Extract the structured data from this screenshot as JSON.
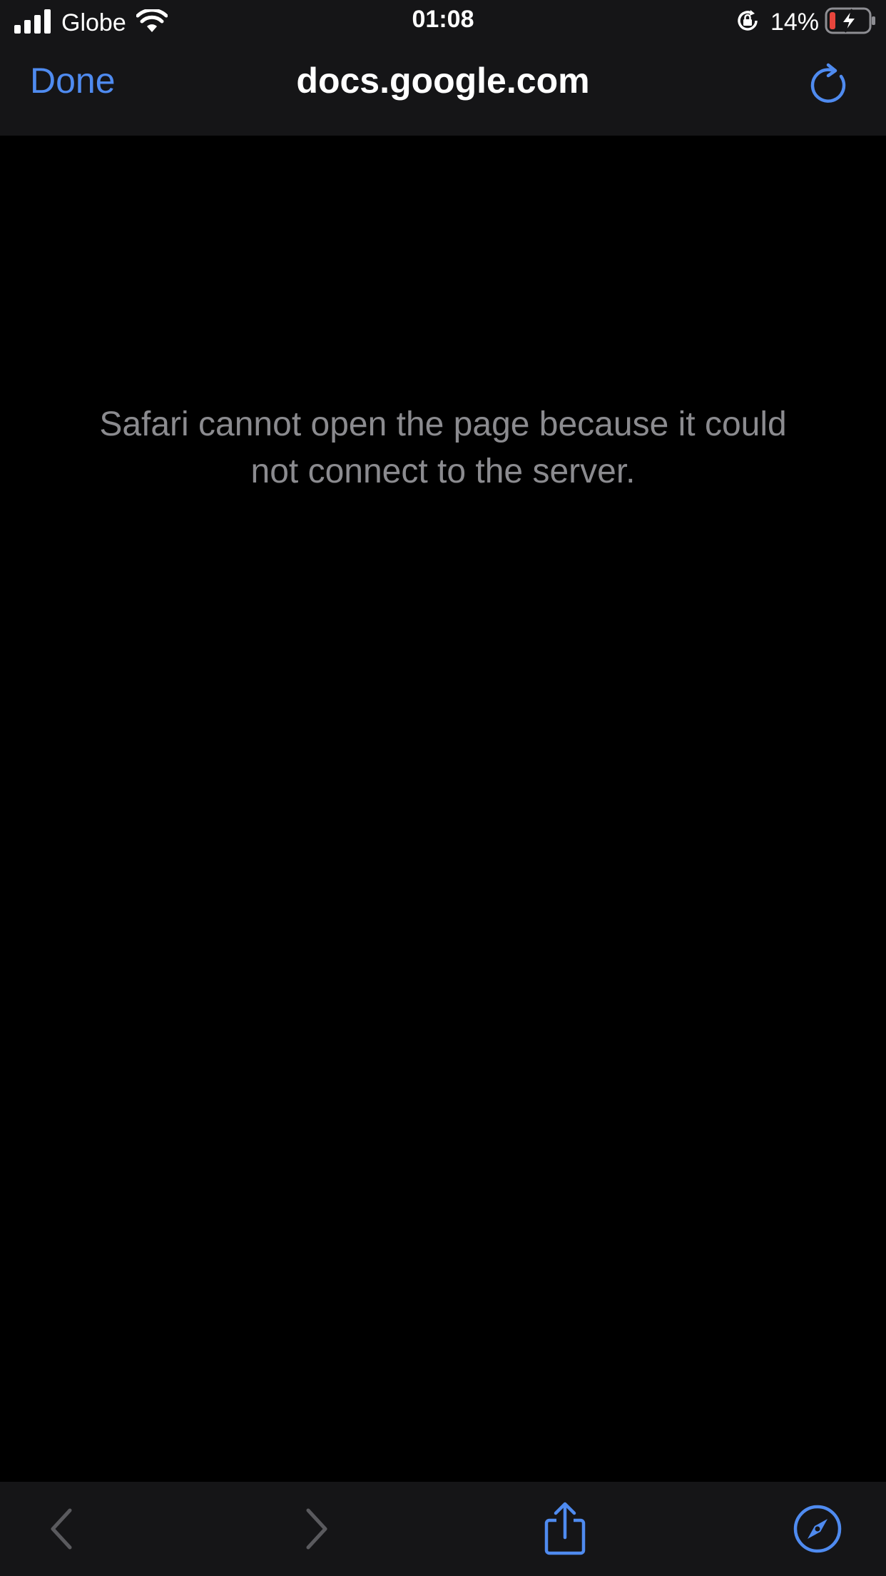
{
  "status_bar": {
    "carrier": "Globe",
    "time": "01:08",
    "battery_percent": "14%",
    "icons": [
      "signal-bars-icon",
      "wifi-icon",
      "orientation-lock-icon",
      "battery-charging-icon"
    ]
  },
  "nav": {
    "done_label": "Done",
    "title": "docs.google.com",
    "reload_icon": "reload-icon"
  },
  "content": {
    "error_message": "Safari cannot open the page because it could not connect to the server."
  },
  "toolbar": {
    "icons": [
      "back-chevron-icon",
      "forward-chevron-icon",
      "share-icon",
      "compass-icon"
    ],
    "back_enabled": false,
    "forward_enabled": false
  },
  "colors": {
    "accent": "#4f8bf0",
    "bar_background": "#151517",
    "page_background": "#000000",
    "error_text": "#8b8b8f",
    "disabled_icon": "#5a5a5e",
    "battery_low": "#e8453c"
  }
}
